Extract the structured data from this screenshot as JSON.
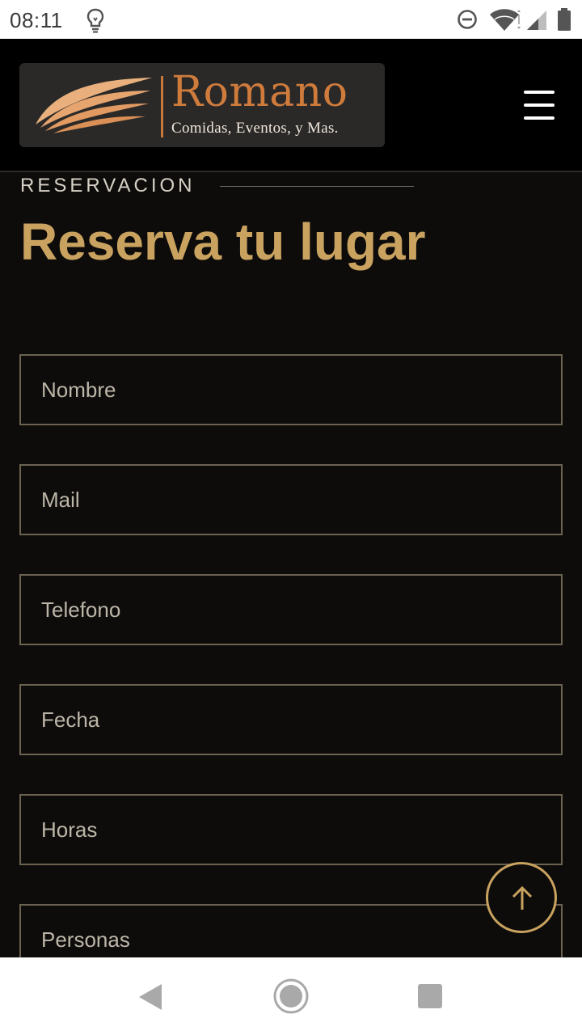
{
  "status_bar": {
    "time": "08:11",
    "icons": [
      "lightbulb-icon",
      "do-not-disturb-icon",
      "wifi-icon",
      "signal-icon",
      "battery-icon"
    ]
  },
  "header": {
    "logo": {
      "name": "Romano",
      "tagline": "Comidas, Eventos, y Mas."
    },
    "menu_icon": "hamburger-menu-icon"
  },
  "section": {
    "eyebrow": "RESERVACION",
    "title": "Reserva tu lugar"
  },
  "form": {
    "fields": [
      {
        "placeholder": "Nombre"
      },
      {
        "placeholder": "Mail"
      },
      {
        "placeholder": "Telefono"
      },
      {
        "placeholder": "Fecha"
      },
      {
        "placeholder": "Horas"
      },
      {
        "placeholder": "Personas"
      }
    ]
  },
  "scroll_top_icon": "arrow-up-icon",
  "nav_bar": {
    "icons": [
      "back-icon",
      "home-icon",
      "recents-icon"
    ]
  },
  "colors": {
    "background": "#0d0c0b",
    "accent_gold": "#c9a25f",
    "logo_orange": "#cf7b3c",
    "field_border": "#6b6350"
  }
}
